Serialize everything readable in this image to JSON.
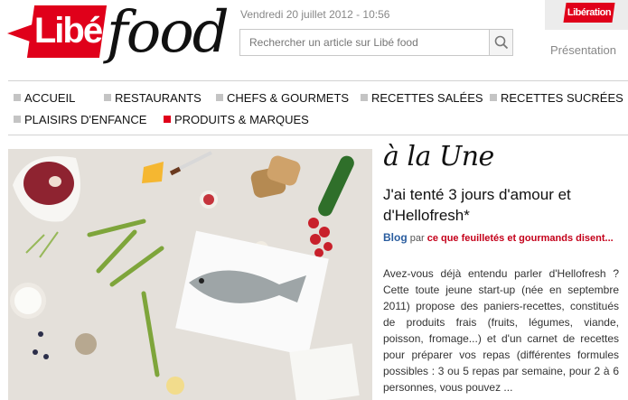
{
  "header": {
    "logo_libe": "Libé",
    "logo_food": "food",
    "date": "Vendredi 20 juillet 2012 - 10:56",
    "search_placeholder": "Rechercher un article sur Libé food",
    "liberation_badge": "Libération",
    "presentation_link": "Présentation"
  },
  "nav": {
    "items": [
      {
        "label": "ACCUEIL",
        "active": false
      },
      {
        "label": "RESTAURANTS",
        "active": false
      },
      {
        "label": "CHEFS & GOURMETS",
        "active": false
      },
      {
        "label": "RECETTES SALÉES",
        "active": false
      },
      {
        "label": "RECETTES SUCRÉES",
        "active": false
      },
      {
        "label": "PLAISIRS D'ENFANCE",
        "active": false
      },
      {
        "label": "PRODUITS & MARQUES",
        "active": true
      }
    ]
  },
  "feature": {
    "section_title": "à la Une",
    "article_title": "J'ai tenté 3 jours d'amour et d'Hellofresh*",
    "meta_blog": "Blog",
    "meta_by": "par",
    "meta_author": "ce que feuilletés et gourmands disent...",
    "excerpt": "Avez-vous déjà entendu parler d'Hellofresh ? Cette toute jeune start-up (née en septembre 2011) propose des paniers-recettes, constitués de produits frais (fruits, légumes, viande, poisson, fromage...) et d'un carnet de recettes pour préparer vos repas (différentes formules possibles : 3 ou 5 repas par semaine, pour 2 à 6 personnes, vous pouvez ..."
  },
  "colors": {
    "brand_red": "#e0001a",
    "link_blue": "#2a5d9f",
    "nav_square_inactive": "#c4c4c4"
  }
}
